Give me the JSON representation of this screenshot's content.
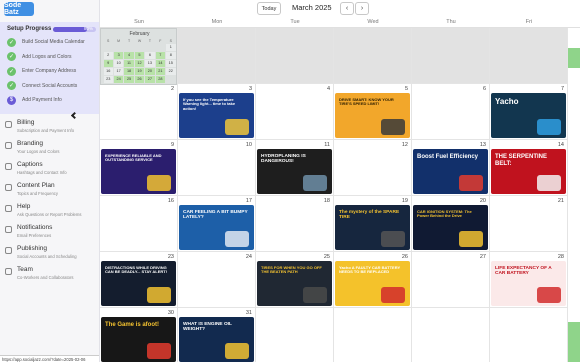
{
  "logo": {
    "text": "Sode Batz"
  },
  "setup": {
    "title": "Setup Progress",
    "percent_label": "80%",
    "progress": 0.8,
    "steps": [
      {
        "label": "Build Social Media Calendar",
        "done": true
      },
      {
        "label": "Add Logos and Colors",
        "done": true
      },
      {
        "label": "Enter Company Address",
        "done": true
      },
      {
        "label": "Connect Social Accounts",
        "done": true
      },
      {
        "label": "Add Payment Info",
        "done": false
      }
    ]
  },
  "nav": [
    {
      "title": "Billing",
      "sub": "Subscription and Payment Info"
    },
    {
      "title": "Branding",
      "sub": "Your Logos and Colors"
    },
    {
      "title": "Captions",
      "sub": "Hashtags and Contact Info"
    },
    {
      "title": "Content Plan",
      "sub": "Topics and Frequency"
    },
    {
      "title": "Help",
      "sub": "Ask Questions or Report Problems"
    },
    {
      "title": "Notifications",
      "sub": "Email Preferences"
    },
    {
      "title": "Publishing",
      "sub": "Social Accounts and Scheduling"
    },
    {
      "title": "Team",
      "sub": "Co-Workers and Collaborators"
    }
  ],
  "mini_calendar": {
    "title": "February",
    "dow": [
      "S",
      "M",
      "T",
      "W",
      "T",
      "F",
      "S"
    ],
    "days": [
      "",
      "",
      "",
      "",
      "",
      "",
      "1",
      "2",
      "3",
      "4",
      "5",
      "6",
      "7",
      "8",
      "9",
      "10",
      "11",
      "12",
      "13",
      "14",
      "15",
      "16",
      "17",
      "18",
      "19",
      "20",
      "21",
      "22",
      "23",
      "24",
      "25",
      "26",
      "27",
      "28",
      ""
    ],
    "highlighted": [
      3,
      4,
      5,
      7,
      9,
      11,
      12,
      14,
      18,
      19,
      20,
      21,
      24,
      25,
      26,
      27,
      28
    ]
  },
  "header": {
    "today_label": "Today",
    "month_label": "March 2025",
    "prev_label": "‹",
    "next_label": "›"
  },
  "weekdays": [
    "Sun",
    "Mon",
    "Tue",
    "Wed",
    "Thu",
    "Fri"
  ],
  "weeks": [
    [
      {
        "day": "",
        "gray": true
      },
      {
        "day": "",
        "gray": true
      },
      {
        "day": "",
        "gray": true
      },
      {
        "day": "",
        "gray": true
      },
      {
        "day": "",
        "gray": true
      },
      {
        "day": "",
        "gray": true
      }
    ],
    [
      {
        "day": "2"
      },
      {
        "day": "3",
        "post": {
          "text": "If you see the Temperature Warning light... time to take action!",
          "bg": "#1c3f8c",
          "fg": "#ffffff",
          "accent": "#f0c53a"
        }
      },
      {
        "day": "4"
      },
      {
        "day": "5",
        "post": {
          "text": "DRIVE SMART: KNOW YOUR TIRE'S SPEED LIMIT!",
          "bg": "#f2a72b",
          "fg": "#2b1d00",
          "accent": "#3a3a3a"
        }
      },
      {
        "day": "6"
      },
      {
        "day": "7",
        "post": {
          "text": "Yacho",
          "bg": "#12364f",
          "fg": "#ffffff",
          "accent": "#2f9ee0"
        }
      }
    ],
    [
      {
        "day": "9",
        "post": {
          "text": "EXPERIENCE RELIABLE AND OUTSTANDING SERVICE",
          "bg": "#2b1e6e",
          "fg": "#ffffff",
          "accent": "#f2c230"
        }
      },
      {
        "day": "10"
      },
      {
        "day": "11",
        "post": {
          "text": "HYDROPLANING IS DANGEROUS!",
          "bg": "#1e1e1e",
          "fg": "#ffffff",
          "accent": "#6e8fa8"
        }
      },
      {
        "day": "12"
      },
      {
        "day": "13",
        "post": {
          "text": "Boost Fuel Efficiency",
          "bg": "#12306b",
          "fg": "#ffffff",
          "accent": "#e33b2e"
        }
      },
      {
        "day": "14",
        "post": {
          "text": "THE SERPENTINE BELT:",
          "bg": "#c0121e",
          "fg": "#ffffff",
          "accent": "#f2f2f2"
        }
      }
    ],
    [
      {
        "day": "16"
      },
      {
        "day": "17",
        "post": {
          "text": "CAR FEELING A BIT BUMPY LATELY?",
          "bg": "#1d5fa8",
          "fg": "#ffffff",
          "accent": "#e0e8f2"
        }
      },
      {
        "day": "18"
      },
      {
        "day": "19",
        "post": {
          "text": "The mystery of the SPARE TIRE",
          "bg": "#16263e",
          "fg": "#f5c330",
          "accent": "#555555"
        }
      },
      {
        "day": "20",
        "post": {
          "text": "CAR IGNITION SYSTEM: The Power Behind the Drive",
          "bg": "#101a33",
          "fg": "#f5c330",
          "accent": "#f2c230"
        }
      },
      {
        "day": "21"
      }
    ],
    [
      {
        "day": "23",
        "post": {
          "text": "DISTRACTIONS WHILE DRIVING CAN BE DEADLY... STAY ALERT!",
          "bg": "#141d2e",
          "fg": "#ffffff",
          "accent": "#f2c230"
        }
      },
      {
        "day": "24"
      },
      {
        "day": "25",
        "post": {
          "text": "TIRES FOR WHEN YOU GO OFF THE BEATEN PATH",
          "bg": "#202833",
          "fg": "#f5c330",
          "accent": "#4a4a4a"
        }
      },
      {
        "day": "26",
        "post": {
          "text": "Yacho A FAULTY CAR BATTERY NEEDS TO BE REPLACED",
          "bg": "#f4c22b",
          "fg": "#ffffff",
          "accent": "#d12c2c"
        }
      },
      {
        "day": "27"
      },
      {
        "day": "28",
        "post": {
          "text": "LIFE EXPECTANCY OF A CAR BATTERY",
          "bg": "#fbe9e9",
          "fg": "#c0121e",
          "accent": "#d12c2c"
        }
      }
    ],
    [
      {
        "day": "30",
        "post": {
          "text": "The Game is afoot!",
          "bg": "#171717",
          "fg": "#f5c330",
          "accent": "#e33b2e"
        }
      },
      {
        "day": "31",
        "post": {
          "text": "WHAT IS ENGINE OIL WEIGHT?",
          "bg": "#122a4f",
          "fg": "#ffffff",
          "accent": "#f2c230"
        }
      },
      {
        "day": ""
      },
      {
        "day": ""
      },
      {
        "day": ""
      },
      {
        "day": ""
      }
    ]
  ],
  "status_url": "https://app.socialjazz.com/?date=2025-02-06"
}
